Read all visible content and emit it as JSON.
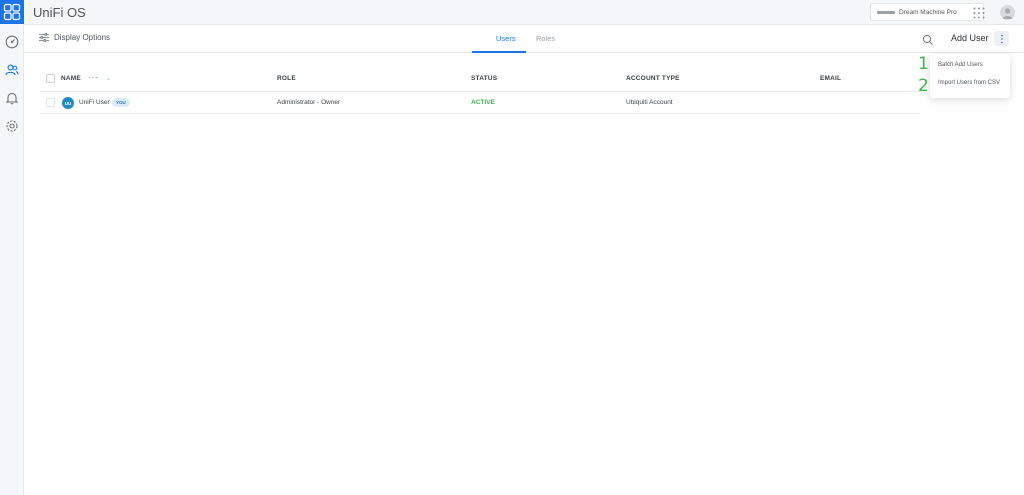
{
  "app": {
    "title": "UniFi OS"
  },
  "topbar": {
    "device_name": "Dream Machine Pro"
  },
  "toolbar": {
    "display_options_label": "Display Options",
    "tabs": [
      {
        "label": "Users",
        "active": true
      },
      {
        "label": "Roles",
        "active": false
      }
    ],
    "add_user_label": "Add User"
  },
  "menu": {
    "items": [
      {
        "number": "1",
        "label": "Batch Add Users"
      },
      {
        "number": "2",
        "label": "Import Users from CSV"
      }
    ]
  },
  "table": {
    "columns": [
      "NAME",
      "ROLE",
      "STATUS",
      "ACCOUNT TYPE",
      "EMAIL"
    ],
    "name_more": "···",
    "sort_arrow": "⌄",
    "rows": [
      {
        "initials": "UU",
        "name": "UniFi User",
        "badge": "YOU",
        "role": "Administrator - Owner",
        "status": "ACTIVE",
        "account_type": "Ubiquiti Account",
        "email": ""
      }
    ]
  },
  "colors": {
    "accent": "#1a73e8",
    "status_active": "#3bb44a",
    "avatar": "#1f8ac0"
  },
  "icons": {
    "rail": [
      "unifi-logo-icon",
      "dashboard-icon",
      "users-icon",
      "bell-icon",
      "gear-icon"
    ],
    "toolbar": [
      "sliders-icon",
      "search-icon",
      "more-vertical-icon"
    ],
    "topbar": [
      "device-icon",
      "apps-grid-icon",
      "profile-avatar-icon"
    ]
  }
}
